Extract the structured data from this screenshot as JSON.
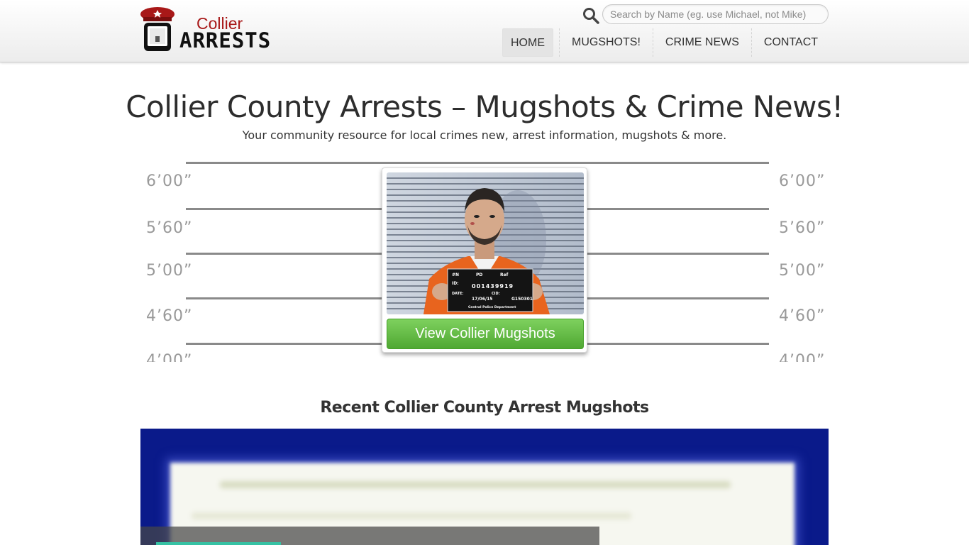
{
  "header": {
    "logo": {
      "top_text": "Collier",
      "bottom_text": "ARRESTS"
    },
    "search": {
      "placeholder": "Search by Name (eg. use Michael, not Mike)",
      "value": ""
    },
    "nav": [
      {
        "label": "HOME",
        "active": true
      },
      {
        "label": "MUGSHOTS!",
        "active": false
      },
      {
        "label": "CRIME NEWS",
        "active": false
      },
      {
        "label": "CONTACT",
        "active": false
      }
    ]
  },
  "hero": {
    "title": "Collier County Arrests – Mugshots & Crime News!",
    "subtitle": "Your community resource for local crimes new, arrest information, mugshots & more.",
    "height_labels": [
      "6’00”",
      "5’60”",
      "5’00”",
      "4’60”",
      "4’00”"
    ],
    "mugshot_board": {
      "row1": [
        "#N",
        "PD",
        "Ref"
      ],
      "id_label": "ID:",
      "id_value": "001439919",
      "date_label": "DATE:",
      "date_value": "17/06/15",
      "cid_label": "CID:",
      "cid_value": "G150301",
      "footer": "Central Police Department"
    },
    "button_label": "View Collier Mugshots"
  },
  "recent": {
    "title": "Recent Collier County Arrest Mugshots"
  },
  "colors": {
    "brand_red": "#a81818",
    "button_green": "#5cb83a",
    "banner_blue": "#0a1a8a",
    "tag_teal": "#36c2a4"
  }
}
